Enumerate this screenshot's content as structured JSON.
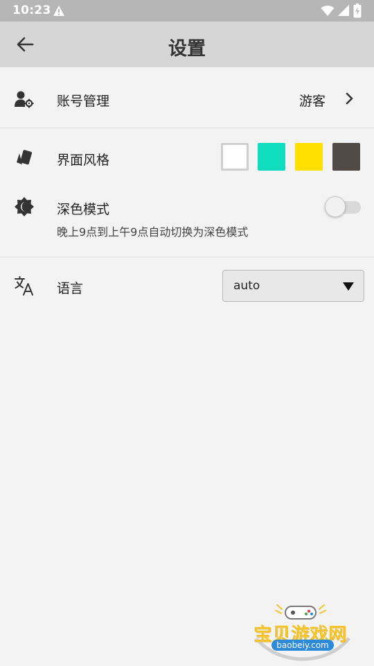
{
  "status_bar": {
    "time": "10:23",
    "icons": [
      "alert-icon",
      "wifi-icon",
      "signal-icon",
      "battery-charging-icon"
    ]
  },
  "app_bar": {
    "title": "设置",
    "back_icon": "arrow-left-icon"
  },
  "settings": {
    "account": {
      "icon": "user-gear-icon",
      "label": "账号管理",
      "value": "游客",
      "chevron_icon": "chevron-right-icon"
    },
    "theme": {
      "icon": "palette-cards-icon",
      "label": "界面风格",
      "swatches": [
        {
          "name": "white",
          "color": "#ffffff",
          "selected": true
        },
        {
          "name": "teal",
          "color": "#10dcc0",
          "selected": false
        },
        {
          "name": "yellow",
          "color": "#ffe000",
          "selected": false
        },
        {
          "name": "dark",
          "color": "#514b48",
          "selected": false
        }
      ]
    },
    "dark_mode": {
      "icon": "brightness-moon-icon",
      "label": "深色模式",
      "description": "晚上9点到上午9点自动切换为深色模式",
      "enabled": false
    },
    "language": {
      "icon": "translate-icon",
      "label": "语言",
      "selected": "auto",
      "caret_icon": "triangle-down-icon"
    }
  },
  "watermark": {
    "text": "宝贝游戏网",
    "url": "baobeiy.com"
  }
}
